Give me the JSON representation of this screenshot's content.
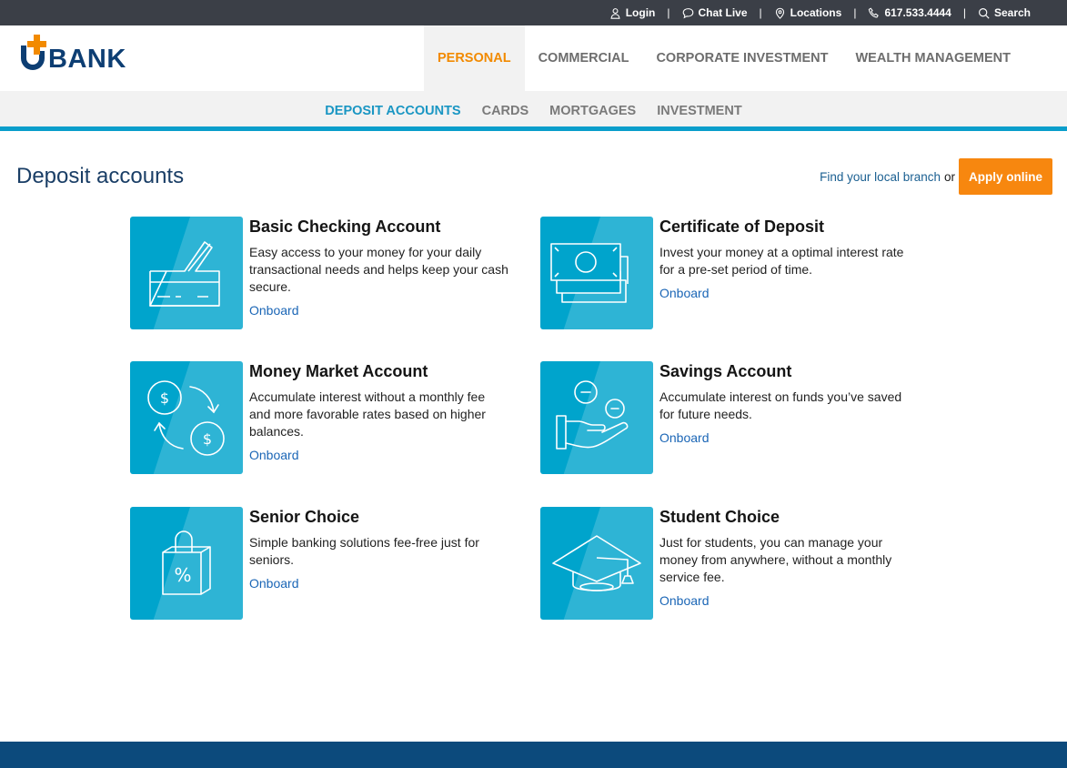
{
  "utility": {
    "login": "Login",
    "chat": "Chat Live",
    "locations": "Locations",
    "phone": "617.533.4444",
    "search": "Search",
    "separator": "|"
  },
  "brand": {
    "name": "BANK",
    "colors": {
      "navy": "#0d3e73",
      "orange": "#f28a00",
      "teal": "#00a4cc"
    }
  },
  "main_nav": [
    "PERSONAL",
    "COMMERCIAL",
    "CORPORATE INVESTMENT",
    "WEALTH MANAGEMENT"
  ],
  "sub_nav": [
    "DEPOSIT ACCOUNTS",
    "CARDS",
    "MORTGAGES",
    "INVESTMENT"
  ],
  "page": {
    "title": "Deposit accounts",
    "branch_link": "Find your local branch",
    "or": "or",
    "apply": "Apply online"
  },
  "cards": [
    {
      "title": "Basic Checking Account",
      "desc": "Easy access to your money for your daily transactional needs and helps keep your cash secure.",
      "link": "Onboard",
      "icon": "check-card-icon"
    },
    {
      "title": "Certificate of Deposit",
      "desc": "Invest your money at a optimal interest rate for a pre-set period of time.",
      "link": "Onboard",
      "icon": "banknotes-icon"
    },
    {
      "title": "Money Market Account",
      "desc": "Accumulate interest without a monthly fee and more favorable rates based on higher balances.",
      "link": "Onboard",
      "icon": "money-exchange-icon"
    },
    {
      "title": "Savings Account",
      "desc": "Accumulate interest on funds you’ve saved for future needs.",
      "link": "Onboard",
      "icon": "hand-coins-icon"
    },
    {
      "title": "Senior Choice",
      "desc": "Simple banking solutions fee-free just for seniors.",
      "link": "Onboard",
      "icon": "shopping-bag-percent-icon"
    },
    {
      "title": "Student Choice",
      "desc": "Just for students, you can manage your money from anywhere, without a monthly service fee.",
      "link": "Onboard",
      "icon": "graduation-cap-icon"
    }
  ]
}
